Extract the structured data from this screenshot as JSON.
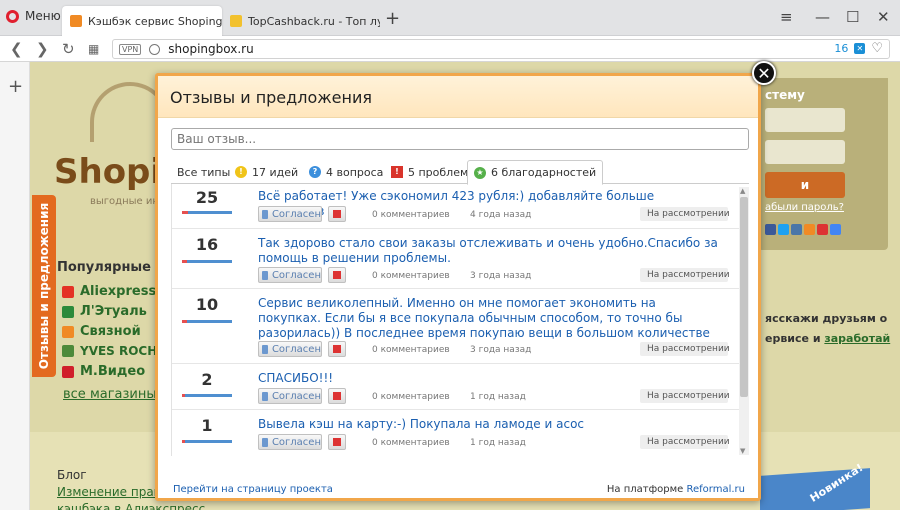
{
  "browser": {
    "menu_label": "Меню",
    "tabs": [
      {
        "title": "Кэшбэк сервис Shopingbo",
        "active": true
      },
      {
        "title": "TopCashback.ru - Топ луч",
        "active": false
      }
    ],
    "url": "shopingbox.ru",
    "vpn_label": "VPN",
    "tracker_count": "16"
  },
  "site": {
    "logo": "Shopi",
    "logo_sub": "выгодные ин",
    "popular_title": "Популярные ма",
    "stores": [
      {
        "name": "Aliexpress",
        "color": "#e43225"
      },
      {
        "name": "Л'Этуаль",
        "color": "#2c8a3b"
      },
      {
        "name": "Связной",
        "color": "#f08a24"
      },
      {
        "name": "YVES ROCHE",
        "color": "#4d8a3a"
      },
      {
        "name": "М.Видео",
        "color": "#d01f2a"
      }
    ],
    "all_stores": "все магазины",
    "feedback_tab": "Отзывы и предложения",
    "login_title": "стему",
    "login_button": "и",
    "forgot": "абыли пароль?",
    "tell_1": "ясскажи друзьям о",
    "tell_2_prefix": "ервисе и ",
    "tell_2_link": "заработай",
    "blog_title": "Блог",
    "blog_link": "Изменение прав",
    "blog_link_2": "кэшбэка в Алиэкспресс",
    "promo": "Новинка!"
  },
  "modal": {
    "title": "Отзывы и предложения",
    "input_placeholder": "Ваш отзыв...",
    "tabs": [
      {
        "label": "Все типы",
        "icon": ""
      },
      {
        "label": "17 идей",
        "icon": "lightbulb-icon",
        "color": "#f0c419"
      },
      {
        "label": "4 вопроса",
        "icon": "question-icon",
        "color": "#3c8fdc"
      },
      {
        "label": "5 проблем",
        "icon": "warning-icon",
        "color": "#d9342b"
      },
      {
        "label": "6 благодарностей",
        "icon": "star-icon",
        "color": "#56b04a"
      }
    ],
    "items": [
      {
        "votes": "25",
        "against": 0.12,
        "text": "Всё работает! Уже сэкономил 423 рубля:) добавляйте больше магазинов",
        "agree": "Согласен",
        "comments": "0 комментариев",
        "ago": "4 года назад",
        "status": "На рассмотрении"
      },
      {
        "votes": "16",
        "against": 0.1,
        "text": "Так здорово стало свои заказы отслеживать и очень удобно.Спасибо за помощь в решении проблемы.",
        "agree": "Согласен",
        "comments": "0 комментариев",
        "ago": "3 года назад",
        "status": "На рассмотрении"
      },
      {
        "votes": "10",
        "against": 0.1,
        "text": "Сервис великолепный. Именно он мне помогает экономить на покупках. Если бы я все покупала обычным способом, то точно бы разорилась)) В последнее время покупаю вещи в большом количестве )",
        "agree": "Согласен",
        "comments": "0 комментариев",
        "ago": "3 года назад",
        "status": "На рассмотрении"
      },
      {
        "votes": "2",
        "against": 0.05,
        "text": "СПАСИБО!!!",
        "agree": "Согласен",
        "comments": "0 комментариев",
        "ago": "1 год назад",
        "status": "На рассмотрении"
      },
      {
        "votes": "1",
        "against": 0.05,
        "text": "Вывела кэш на карту:-) Покупала на ламоде и асос",
        "agree": "Согласен",
        "comments": "0 комментариев",
        "ago": "1 год назад",
        "status": "На рассмотрении"
      }
    ],
    "footer_link": "Перейти на страницу проекта",
    "platform_prefix": "На платформе",
    "platform_name": "Reformal.ru"
  },
  "colors": {
    "accent": "#f1a64a",
    "link": "#1b5fb0",
    "site_orange": "#e36a1f"
  }
}
